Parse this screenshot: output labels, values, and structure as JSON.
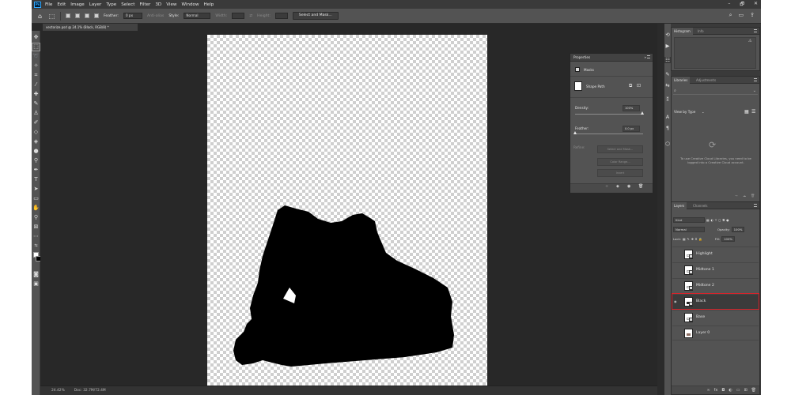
{
  "app": {
    "logo": "Ps"
  },
  "menu": [
    "File",
    "Edit",
    "Image",
    "Layer",
    "Type",
    "Select",
    "Filter",
    "3D",
    "View",
    "Window",
    "Help"
  ],
  "window_controls": [
    "–",
    "🗗",
    "✕"
  ],
  "options": {
    "feather_label": "Feather:",
    "feather_value": "0 px",
    "antialias_label": "Anti-alias",
    "style_label": "Style:",
    "style_value": "Normal",
    "width_label": "Width:",
    "height_label": "Height:",
    "select_mask_button": "Select and Mask..."
  },
  "document": {
    "tab_title": "vectorize.psd @ 24.1% (Black, RGB/8) *"
  },
  "status": {
    "zoom": "24.42%",
    "doc_size": "Doc: 32.7M/72.4M"
  },
  "properties": {
    "title": "Properties",
    "section_label": "Masks",
    "shape_path_label": "Shape Path",
    "density_label": "Density:",
    "density_value": "100%",
    "feather_label": "Feather:",
    "feather_value": "0.0 px",
    "refine_label": "Refine:",
    "select_mask_button": "Select and Mask...",
    "color_range_button": "Color Range...",
    "invert_button": "Invert"
  },
  "histogram": {
    "tabs": [
      "Histogram",
      "Info"
    ]
  },
  "libraries": {
    "tabs": [
      "Libraries",
      "Adjustments"
    ],
    "view_by": "View by Type",
    "message": "To use Creative Cloud Libraries, you need to be logged into a Creative Cloud account."
  },
  "layers": {
    "tabs": [
      "Layers",
      "Channels"
    ],
    "filter_kind": "Kind",
    "blend_mode": "Normal",
    "opacity_label": "Opacity:",
    "opacity_value": "100%",
    "lock_label": "Lock:",
    "fill_label": "Fill:",
    "fill_value": "100%",
    "items": [
      {
        "name": "Highlight"
      },
      {
        "name": "Midtone 1"
      },
      {
        "name": "Midtone 2"
      },
      {
        "name": "Black"
      },
      {
        "name": "Base"
      },
      {
        "name": "Layer 0"
      }
    ],
    "selected": "Black"
  },
  "colors": {
    "selection_outline": "#d8232a",
    "panel_bg": "#535353",
    "canvas_bg": "#282828",
    "silhouette": "#000000"
  }
}
